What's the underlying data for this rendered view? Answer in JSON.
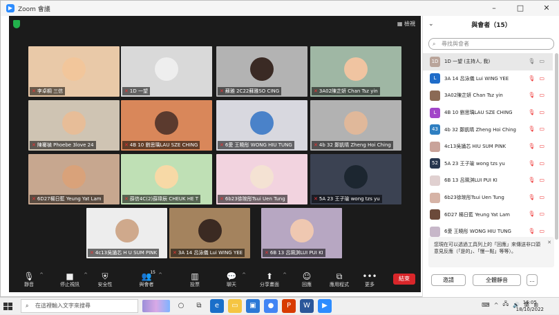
{
  "window": {
    "title": "Zoom 會議",
    "controls": [
      "–",
      "□",
      "✕"
    ]
  },
  "meeting": {
    "view_label": "檢視",
    "tiles": [
      {
        "label": "李卓桐 三信",
        "bg": "#e9c9a8",
        "face": "#f2c69b"
      },
      {
        "label": "1D 一望",
        "bg": "#d9d9d9",
        "face": "#eeeeee",
        "active": true
      },
      {
        "label": "蘇雅 2C22蘇雅SO CING",
        "bg": "#b3b3b3",
        "face": "#3a2a24"
      },
      {
        "label": "3A02陳芷妍 Chan Tsz yin",
        "bg": "#9fb7a4",
        "face": "#f0c4a1"
      },
      {
        "label": "陳騫禎 Phoebe 3love 24",
        "bg": "#cfc4b3",
        "face": "#e7bd98"
      },
      {
        "label": "4B 10 劉思瑀LAU SZE CHING",
        "bg": "#d9875a",
        "face": "#5b3a2e"
      },
      {
        "label": "6愛 王曉彤 WONG HIU TUNG",
        "bg": "#d8d8df",
        "face": "#4a82c9"
      },
      {
        "label": "4b 32 鄭凱晴 Zheng Hoi Ching",
        "bg": "#b2b2b2",
        "face": "#e0b89a"
      },
      {
        "label": "6D27楊日藍 Yeung Yat Lam",
        "bg": "#c7a78f",
        "face": "#d9a27a"
      },
      {
        "label": "薛信4C(2)薛瑋辰 CHEUK HE T",
        "bg": "#bfe0b5",
        "face": "#f7d9a6"
      },
      {
        "label": "6b23徐琬彤Tsui Uen Tung",
        "bg": "#f2d3df",
        "face": "#f4e2d3"
      },
      {
        "label": "5A 23 王子瑜 wong tzs yu",
        "bg": "#3b4252",
        "face": "#1c2630"
      },
      {
        "label": "4c13吳誦芯 H U SUM PINK",
        "bg": "#ededed",
        "face": "#cfa98c"
      },
      {
        "label": "3A 14 呂泳儀 Lui WING YEE",
        "bg": "#a4835e",
        "face": "#3b2a22"
      },
      {
        "label": "6B 13 呂珮淇LUI PUI KI",
        "bg": "#b7a7c2",
        "face": "#efc8b1"
      }
    ]
  },
  "toolbar": {
    "mute": "靜音",
    "stop_video": "停止視訊",
    "security": "安全性",
    "participants": "與會者",
    "participants_count": "15",
    "poll": "投票",
    "chat": "聊天",
    "share": "分享畫面",
    "reactions": "回應",
    "apps": "應用程式",
    "more": "更多",
    "end": "結束"
  },
  "panel": {
    "title": "與會者（15）",
    "search_placeholder": "尋找與會者",
    "participants": [
      {
        "avatar": "1D",
        "color": "#b9a49a",
        "name": "1D 一望 (主持人, 我)",
        "self": true
      },
      {
        "avatar": "L",
        "color": "#1f6cc9",
        "name": "3A 14 呂泳儀 Lui WING YEE"
      },
      {
        "avatar": "",
        "color": "#8b6a55",
        "name": "3A02陳芷妍 Chan Tsz yin"
      },
      {
        "avatar": "L",
        "color": "#a246c9",
        "name": "4B 10 劉思瑀LAU SZE CHING"
      },
      {
        "avatar": "43",
        "color": "#2f7fc1",
        "name": "4b 32 鄭凱晴 Zheng Hoi Ching"
      },
      {
        "avatar": "",
        "color": "#c9a39a",
        "name": "4c13吳誦芯 HIU SUM PINK"
      },
      {
        "avatar": "52",
        "color": "#27364f",
        "name": "5A 23 王子瑜 wong tzs yu"
      },
      {
        "avatar": "",
        "color": "#e0d0d0",
        "name": "6B 13 呂珮淇LUI PUI KI"
      },
      {
        "avatar": "",
        "color": "#d6b3a6",
        "name": "6b23徐琬彤Tsui Uen Tung"
      },
      {
        "avatar": "",
        "color": "#6b4a3a",
        "name": "6D27 楊日藍 Yeung Yat Lam"
      },
      {
        "avatar": "",
        "color": "#c7b7c9",
        "name": "6愛 王曉彤 WONG HIU TUNG"
      },
      {
        "avatar": "",
        "color": "#dccbd8",
        "name": ""
      }
    ],
    "tip": "您現在可以透過工具列上的「回應」來傳送非口頭意見反應（「是的」、「慢一點」等等）。",
    "invite": "邀請",
    "mute_all": "全體靜音",
    "more": "..."
  },
  "taskbar": {
    "search_placeholder": "在這裡輸入文字來搜尋",
    "lang": "英",
    "time": "16:05",
    "date": "18/10/2022"
  }
}
